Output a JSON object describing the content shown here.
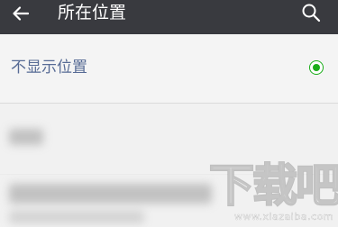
{
  "header": {
    "title": "所在位置",
    "back_icon": "arrow-left-icon",
    "search_icon": "search-icon",
    "background_color": "#393a3f"
  },
  "options": [
    {
      "label": "不显示位置",
      "selected": true,
      "label_color": "#576b95",
      "selected_indicator_color": "#1aad19"
    }
  ],
  "watermark": {
    "text": "下载吧",
    "url": "www.xiazaiba.com"
  }
}
